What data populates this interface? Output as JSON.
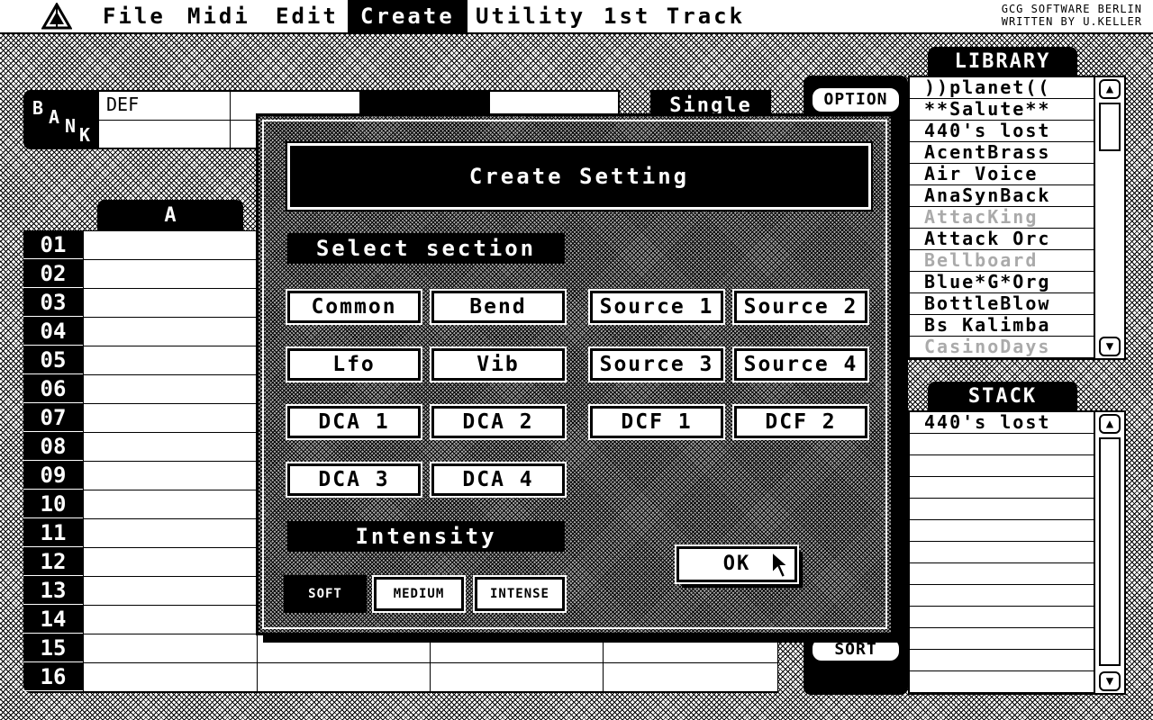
{
  "menu": {
    "items": [
      "File",
      "Midi",
      "Edit",
      "Create",
      "Utility",
      "1st Track"
    ],
    "active": "Create",
    "credits_line1": "GCG SOFTWARE BERLIN",
    "credits_line2": "WRITTEN BY U.KELLER"
  },
  "bank": {
    "label_b": "B",
    "label_a": "A",
    "label_n": "N",
    "label_k": "K",
    "name": "DEF",
    "mode": "Single"
  },
  "patches": {
    "column_label": "A",
    "numbers": [
      "01",
      "02",
      "03",
      "04",
      "05",
      "06",
      "07",
      "08",
      "09",
      "10",
      "11",
      "12",
      "13",
      "14",
      "15",
      "16"
    ]
  },
  "side": {
    "option_label": "OPTION",
    "sort_label": "SORT"
  },
  "library": {
    "title": "LIBRARY",
    "items": [
      {
        "name": "))planet((",
        "dim": false
      },
      {
        "name": "**Salute**",
        "dim": false
      },
      {
        "name": "440's lost",
        "dim": false
      },
      {
        "name": "AcentBrass",
        "dim": false
      },
      {
        "name": "Air Voice",
        "dim": false
      },
      {
        "name": "AnaSynBack",
        "dim": false
      },
      {
        "name": "AttacKing",
        "dim": true
      },
      {
        "name": "Attack Orc",
        "dim": false
      },
      {
        "name": "Bellboard",
        "dim": true
      },
      {
        "name": "Blue*G*Org",
        "dim": false
      },
      {
        "name": "BottleBlow",
        "dim": false
      },
      {
        "name": "Bs Kalimba",
        "dim": false
      },
      {
        "name": "CasinoDays",
        "dim": true
      }
    ]
  },
  "stack": {
    "title": "STACK",
    "items": [
      "440's lost"
    ]
  },
  "dialog": {
    "title": "Create Setting",
    "select_label": "Select section",
    "sections": {
      "common": "Common",
      "bend": "Bend",
      "source1": "Source 1",
      "source2": "Source 2",
      "lfo": "Lfo",
      "vib": "Vib",
      "source3": "Source 3",
      "source4": "Source 4",
      "dca1": "DCA 1",
      "dca2": "DCA 2",
      "dcf1": "DCF 1",
      "dcf2": "DCF 2",
      "dca3": "DCA 3",
      "dca4": "DCA 4"
    },
    "intensity_label": "Intensity",
    "intensity": {
      "soft": "SOFT",
      "medium": "MEDIUM",
      "intense": "INTENSE",
      "selected": "SOFT"
    },
    "ok_label": "OK"
  }
}
